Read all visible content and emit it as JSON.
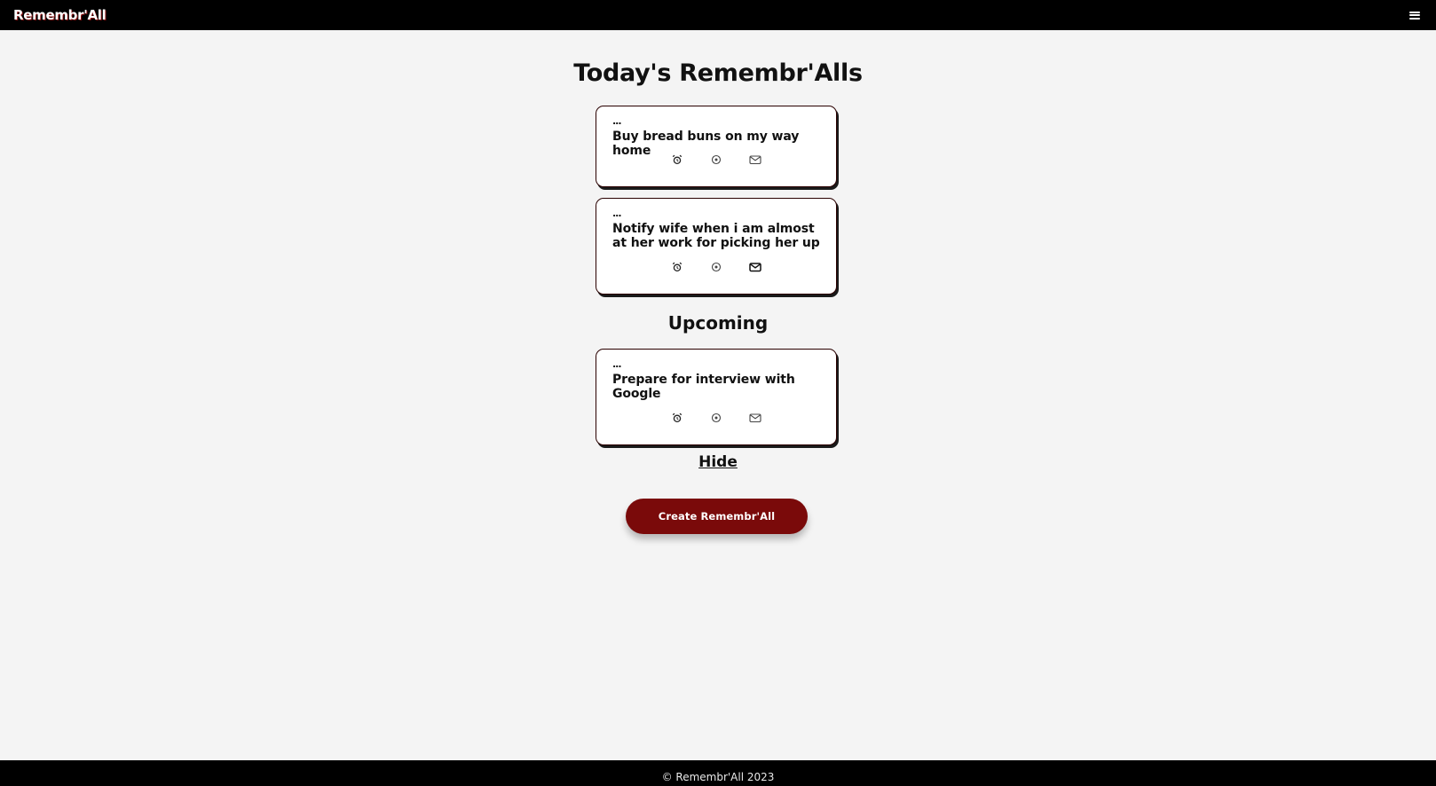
{
  "navbar": {
    "brand": "Remembr'All",
    "menu_icon": "hamburger-menu-icon"
  },
  "main": {
    "title": "Today's Remembr'Alls",
    "upcoming_title": "Upcoming",
    "hide_label": "Hide",
    "create_label": "Create Remembr'All"
  },
  "today": [
    {
      "dots": "...",
      "text": "Buy bread buns on my way home",
      "icons": [
        "alarm-clock-icon",
        "location-pin-icon",
        "mail-icon"
      ]
    },
    {
      "dots": "...",
      "text": "Notify wife when i am almost at her work for picking her up",
      "icons": [
        "alarm-clock-icon",
        "location-pin-icon",
        "mail-icon"
      ]
    }
  ],
  "upcoming": [
    {
      "dots": "...",
      "text": "Prepare for interview with Google",
      "icons": [
        "alarm-clock-icon",
        "location-pin-icon",
        "mail-icon"
      ]
    }
  ],
  "footer": {
    "copyright": "© Remembr'All 2023"
  },
  "colors": {
    "navbar": "#000000",
    "page_background": "#f4f4f4",
    "accent": "#7a0a0a",
    "brand_shadow": "#8a0f0f"
  }
}
